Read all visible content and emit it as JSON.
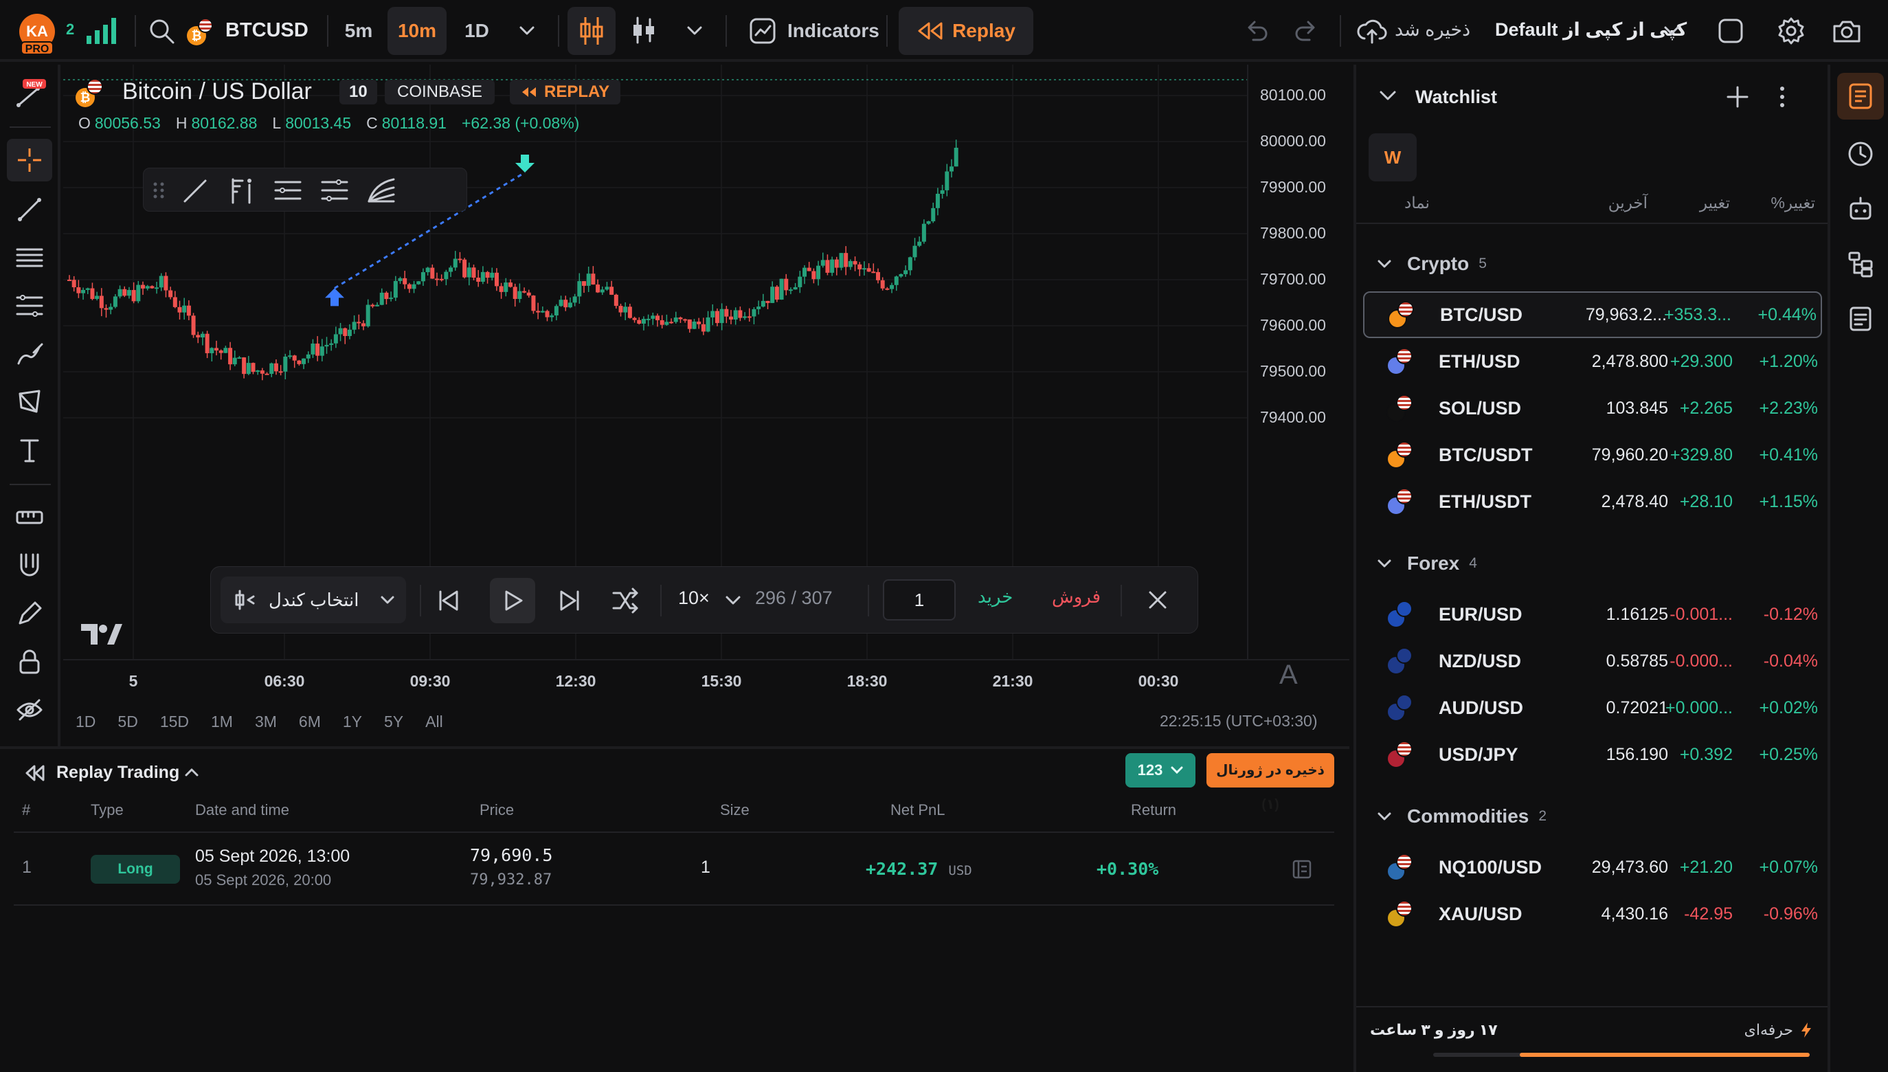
{
  "topbar": {
    "avatar_initials": "KA",
    "pro_badge": "PRO",
    "signal_count": "2",
    "symbol": "BTCUSD",
    "intervals": [
      "5m",
      "10m",
      "1D"
    ],
    "active_interval": "10m",
    "indicators_label": "Indicators",
    "replay_label": "Replay",
    "save_label": "ذخیره شد",
    "layout_name": "کپی از کپی از Default"
  },
  "chart": {
    "title": "Bitcoin / US Dollar",
    "interval_badge": "10",
    "exchange": "COINBASE",
    "replay_badge": "REPLAY",
    "ohlc": {
      "o_label": "O",
      "o": "80056.53",
      "h_label": "H",
      "h": "80162.88",
      "l_label": "L",
      "l": "80013.45",
      "c_label": "C",
      "c": "80118.91",
      "change": "+62.38 (+0.08%)"
    },
    "price_ticks": [
      "80100.00",
      "80000.00",
      "79900.00",
      "79800.00",
      "79700.00",
      "79600.00",
      "79500.00",
      "79400.00"
    ],
    "time_ticks": [
      "5",
      "06:30",
      "09:30",
      "12:30",
      "15:30",
      "18:30",
      "21:30",
      "00:30"
    ],
    "ranges": [
      "1D",
      "5D",
      "15D",
      "1M",
      "3M",
      "6M",
      "1Y",
      "5Y",
      "All"
    ],
    "clock": "22:25:15 (UTC+03:30)",
    "auto_label": "A",
    "colors": {
      "up": "#26a17b",
      "down": "#ef5350",
      "trade_line": "#3d7bff",
      "entry": "#3d7bff",
      "exit": "#3ee2c9"
    }
  },
  "chart_data": {
    "type": "candlestick",
    "x_ticks": [
      "5",
      "06:30",
      "09:30",
      "12:30",
      "15:30",
      "18:30",
      "21:30",
      "00:30"
    ],
    "ylim": [
      79400,
      80140
    ],
    "last_close": 80118.91,
    "trade": {
      "entry_price": 79690.5,
      "exit_price": 79932.87,
      "entry_time": "13:00",
      "exit_time": "20:00"
    }
  },
  "replay": {
    "select_candle": "انتخاب کندل",
    "speed": "10×",
    "progress": "296 / 307",
    "qty": "1",
    "buy": "خرید",
    "sell": "فروش"
  },
  "bottom": {
    "title": "Replay Trading",
    "count_badge": "123",
    "journal_btn": "ذخیره در ژورنال (۱)",
    "columns": [
      "#",
      "Type",
      "Date and time",
      "Price",
      "Size",
      "Net PnL",
      "Return"
    ],
    "rows": [
      {
        "num": "1",
        "type": "Long",
        "date1": "05 Sept 2026, 13:00",
        "date2": "05 Sept 2026, 20:00",
        "price1": "79,690.5",
        "price2": "79,932.87",
        "size": "1",
        "pnl": "+242.37",
        "pnl_unit": "USD",
        "ret": "+0.30%"
      }
    ]
  },
  "watchlist": {
    "title": "Watchlist",
    "w_badge": "W",
    "columns": {
      "symbol": "نماد",
      "last": "آخرین",
      "change": "تغییر",
      "pct": "تغییر%"
    },
    "groups": [
      {
        "name": "Crypto",
        "count": "5",
        "items": [
          {
            "sym": "BTC/USD",
            "last": "79,963.2...",
            "chg": "+353.3...",
            "pct": "+0.44%",
            "dir": "up",
            "coin": "#f7931a"
          },
          {
            "sym": "ETH/USD",
            "last": "2,478.800",
            "chg": "+29.300",
            "pct": "+1.20%",
            "dir": "up",
            "coin": "#627eea"
          },
          {
            "sym": "SOL/USD",
            "last": "103.845",
            "chg": "+2.265",
            "pct": "+2.23%",
            "dir": "up",
            "coin": "#111111"
          },
          {
            "sym": "BTC/USDT",
            "last": "79,960.20",
            "chg": "+329.80",
            "pct": "+0.41%",
            "dir": "up",
            "coin": "#f7931a"
          },
          {
            "sym": "ETH/USDT",
            "last": "2,478.40",
            "chg": "+28.10",
            "pct": "+1.15%",
            "dir": "up",
            "coin": "#627eea"
          }
        ]
      },
      {
        "name": "Forex",
        "count": "4",
        "items": [
          {
            "sym": "EUR/USD",
            "last": "1.16125",
            "chg": "-0.001...",
            "pct": "-0.12%",
            "dir": "dn",
            "coin": "#1e4db7"
          },
          {
            "sym": "NZD/USD",
            "last": "0.58785",
            "chg": "-0.000...",
            "pct": "-0.04%",
            "dir": "dn",
            "coin": "#1e3a8a"
          },
          {
            "sym": "AUD/USD",
            "last": "0.72021",
            "chg": "+0.000...",
            "pct": "+0.02%",
            "dir": "up",
            "coin": "#1e3a8a"
          },
          {
            "sym": "USD/JPY",
            "last": "156.190",
            "chg": "+0.392",
            "pct": "+0.25%",
            "dir": "up",
            "coin": "#b22234"
          }
        ]
      },
      {
        "name": "Commodities",
        "count": "2",
        "items": [
          {
            "sym": "NQ100/USD",
            "last": "29,473.60",
            "chg": "+21.20",
            "pct": "+0.07%",
            "dir": "up",
            "coin": "#2b6cb0"
          },
          {
            "sym": "XAU/USD",
            "last": "4,430.16",
            "chg": "-42.95",
            "pct": "-0.96%",
            "dir": "dn",
            "coin": "#d4a017"
          }
        ]
      }
    ]
  },
  "footer": {
    "remaining": "۱۷ روز و ۳ ساعت",
    "plan": "حرفه‌ای",
    "remaining_fraction": 0.77
  }
}
